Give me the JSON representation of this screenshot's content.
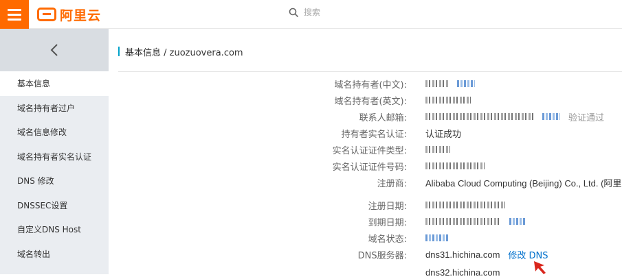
{
  "header": {
    "logo_text": "阿里云",
    "search_placeholder": "搜索"
  },
  "sidebar": {
    "items": [
      {
        "label": "基本信息",
        "active": true
      },
      {
        "label": "域名持有者过户"
      },
      {
        "label": "域名信息修改"
      },
      {
        "label": "域名持有者实名认证"
      },
      {
        "label": "DNS 修改"
      },
      {
        "label": "DNSSEC设置"
      },
      {
        "label": "自定义DNS Host"
      },
      {
        "label": "域名转出"
      }
    ]
  },
  "page": {
    "title": "基本信息 / zuozuovera.com"
  },
  "info": {
    "holder_cn_label": "域名持有者(中文):",
    "holder_en_label": "域名持有者(英文):",
    "email_label": "联系人邮箱:",
    "email_status": "验证通过",
    "realname_label": "持有者实名认证:",
    "realname_value": "认证成功",
    "cert_type_label": "实名认证证件类型:",
    "cert_no_label": "实名认证证件号码:",
    "registrar_label": "注册商:",
    "registrar_value": "Alibaba Cloud Computing (Beijing) Co., Ltd. (阿里巴",
    "reg_date_label": "注册日期:",
    "exp_date_label": "到期日期:",
    "status_label": "域名状态:",
    "dns_label": "DNS服务器:",
    "dns1": "dns31.hichina.com",
    "dns2": "dns32.hichina.com",
    "dns_edit": "修改 DNS"
  },
  "colors": {
    "brand": "#ff6a00",
    "link": "#0070cc",
    "accent_bar": "#00a2ca",
    "cursor": "#d9251c"
  }
}
